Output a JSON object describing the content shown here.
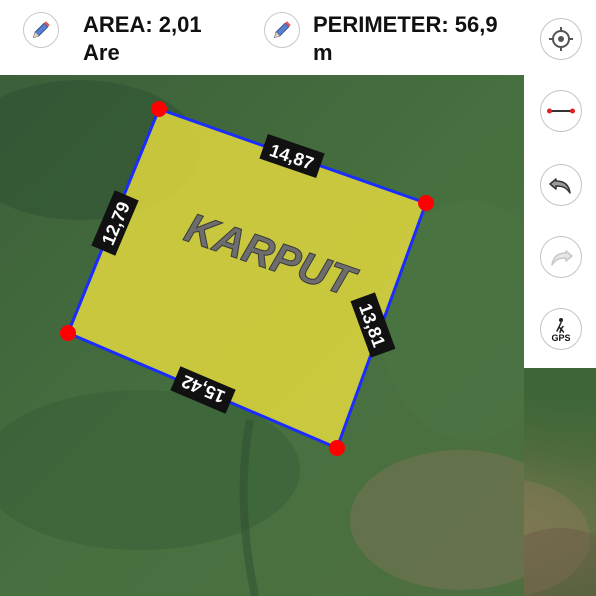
{
  "header": {
    "area_label": "AREA: 2,01",
    "area_unit": "Are",
    "perimeter_label": "PERIMETER: 56,9",
    "perimeter_unit": "m"
  },
  "plot": {
    "name": "KARPUT",
    "side_lengths": [
      "14,87",
      "13,81",
      "15,42",
      "12,79"
    ]
  },
  "icons": {
    "edit": "pencil-icon",
    "locate": "crosshair-icon",
    "measure": "ruler-line-icon",
    "undo": "undo-icon",
    "redo": "redo-icon",
    "gps": "gps-walk-icon"
  },
  "gps_label": "GPS",
  "colors": {
    "polygon_fill": "#d8d34a",
    "polygon_edge": "#1f2fff",
    "vertex": "#ff0000",
    "map_base": "#3f6a3a"
  }
}
